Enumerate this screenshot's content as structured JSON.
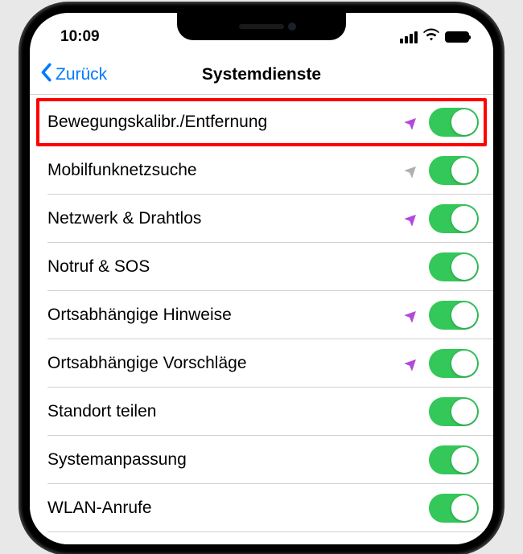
{
  "status": {
    "time": "10:09"
  },
  "nav": {
    "back": "Zurück",
    "title": "Systemdienste"
  },
  "rows": [
    {
      "label": "Bewegungskalibr./Entfernung",
      "icon": "purple",
      "on": true,
      "highlight": true
    },
    {
      "label": "Mobilfunknetzsuche",
      "icon": "gray",
      "on": true
    },
    {
      "label": "Netzwerk & Drahtlos",
      "icon": "purple",
      "on": true
    },
    {
      "label": "Notruf & SOS",
      "icon": "none",
      "on": true
    },
    {
      "label": "Ortsabhängige Hinweise",
      "icon": "purple",
      "on": true
    },
    {
      "label": "Ortsabhängige Vorschläge",
      "icon": "purple",
      "on": true
    },
    {
      "label": "Standort teilen",
      "icon": "none",
      "on": true
    },
    {
      "label": "Systemanpassung",
      "icon": "none",
      "on": true
    },
    {
      "label": "WLAN-Anrufe",
      "icon": "none",
      "on": true
    }
  ]
}
